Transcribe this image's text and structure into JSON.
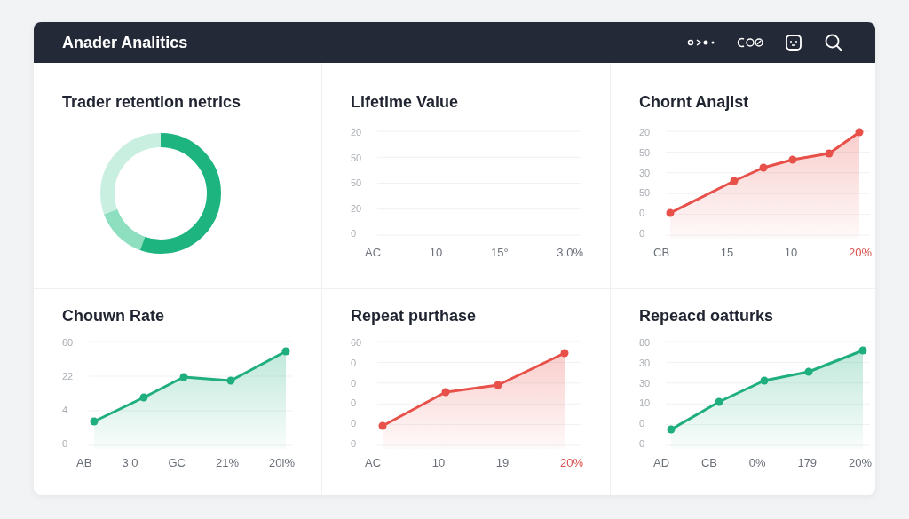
{
  "header": {
    "title": "Anader Analitics"
  },
  "panels": [
    {
      "kind": "donut",
      "title": "Trader retention netrics"
    },
    {
      "kind": "grid",
      "title": "Lifetime Value",
      "y_labels": [
        "20",
        "50",
        "50",
        "20",
        "0"
      ],
      "x_labels": [
        {
          "text": "AC",
          "highlighted": false
        },
        {
          "text": "10",
          "highlighted": false
        },
        {
          "text": "15°",
          "highlighted": false
        },
        {
          "text": "3.0%",
          "highlighted": false
        }
      ]
    },
    {
      "kind": "line",
      "title": "Chornt Anajist",
      "color": "#e8504a",
      "y_labels": [
        "20",
        "50",
        "30",
        "50",
        "0",
        "0"
      ],
      "x_labels": [
        {
          "text": "CB",
          "highlighted": false
        },
        {
          "text": "15",
          "highlighted": false
        },
        {
          "text": "10",
          "highlighted": false
        },
        {
          "text": "20%",
          "highlighted": true
        }
      ]
    },
    {
      "kind": "line",
      "title": "Chouwn Rate",
      "color": "#1fae7e",
      "y_labels": [
        "60",
        "22",
        "4",
        "0"
      ],
      "x_labels": [
        {
          "text": "AB",
          "highlighted": false
        },
        {
          "text": "3 0",
          "highlighted": false
        },
        {
          "text": "GC",
          "highlighted": false
        },
        {
          "text": "21%",
          "highlighted": false
        },
        {
          "text": "20l%",
          "highlighted": false
        }
      ]
    },
    {
      "kind": "line",
      "title": "Repeat purthase",
      "color": "#e8504a",
      "y_labels": [
        "60",
        "0",
        "0",
        "0",
        "0",
        "0"
      ],
      "x_labels": [
        {
          "text": "AC",
          "highlighted": false
        },
        {
          "text": "10",
          "highlighted": false
        },
        {
          "text": "19",
          "highlighted": false
        },
        {
          "text": "20%",
          "highlighted": true
        }
      ]
    },
    {
      "kind": "line",
      "title": "Repeacd oatturks",
      "color": "#1fae7e",
      "y_labels": [
        "80",
        "30",
        "30",
        "10",
        "0",
        "0"
      ],
      "x_labels": [
        {
          "text": "AD",
          "highlighted": false
        },
        {
          "text": "CB",
          "highlighted": false
        },
        {
          "text": "0%",
          "highlighted": false
        },
        {
          "text": "179",
          "highlighted": false
        },
        {
          "text": "20%",
          "highlighted": false
        }
      ]
    }
  ]
}
